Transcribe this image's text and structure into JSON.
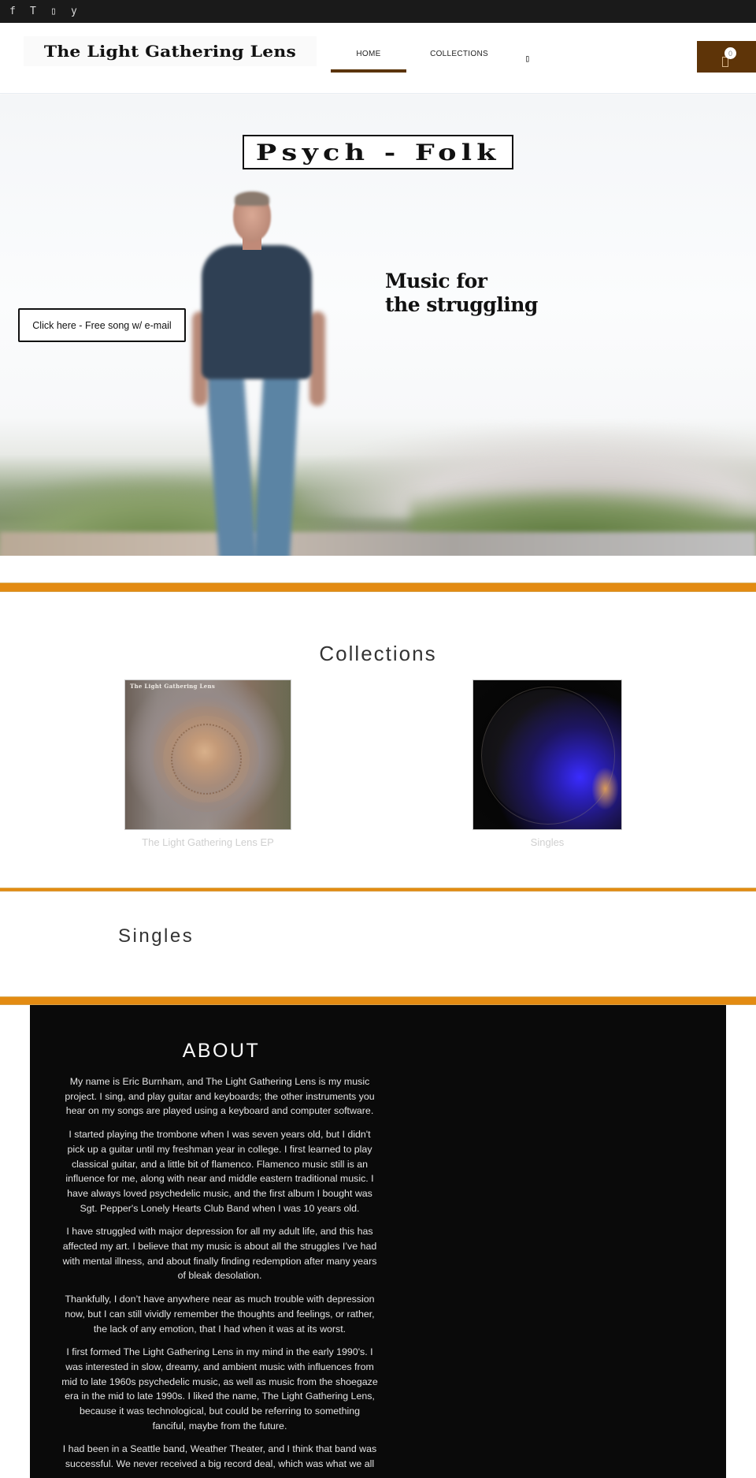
{
  "social": {
    "items": [
      {
        "name": "facebook",
        "glyph": "f"
      },
      {
        "name": "twitter",
        "glyph": "T"
      },
      {
        "name": "instagram",
        "glyph": "▯"
      },
      {
        "name": "youtube",
        "glyph": "y"
      }
    ]
  },
  "header": {
    "logo_text": "The Light Gathering Lens",
    "nav": {
      "home": "HOME",
      "collections": "COLLECTIONS",
      "search_glyph": "▯"
    },
    "cart": {
      "count": "0"
    },
    "accent_color": "#5e3408"
  },
  "hero": {
    "badge": "Psych - Folk",
    "tagline_line1": "Music for",
    "tagline_line2": "the struggling",
    "cta_label": "Click here - Free song w/ e-mail"
  },
  "divider_color": "#e38b12",
  "collections": {
    "title": "Collections",
    "items": [
      {
        "title": "The Light Gathering Lens EP",
        "cover_text": "The Light Gathering Lens"
      },
      {
        "title": "Singles"
      }
    ]
  },
  "singles": {
    "title": "Singles"
  },
  "about": {
    "title": "ABOUT",
    "paragraphs": [
      "My name is Eric Burnham, and The Light Gathering Lens is my music project. I sing, and play guitar and keyboards; the other instruments you hear on my songs are played using a keyboard and computer software.",
      "I started playing the trombone when I was seven years old, but I didn't pick up a guitar until my freshman year in college. I first learned to play classical guitar, and a little bit of flamenco. Flamenco music still is an influence for me, along with near and middle eastern traditional music. I have always loved psychedelic music, and the first album I bought was Sgt. Pepper's Lonely Hearts Club Band when I was 10 years old.",
      "I have struggled with major depression for all my adult life, and this has affected my art. I believe that my music is about all the struggles I’ve had with mental illness, and about finally finding redemption after many years of bleak desolation.",
      "Thankfully, I don’t have anywhere near as much trouble with depression now, but I can still vividly remember the thoughts and feelings, or rather, the lack of any emotion, that I had when it was at its worst.",
      "I first formed The Light Gathering Lens in my mind in the early 1990's. I was interested in slow, dreamy, and ambient music with influences from mid to late 1960s psychedelic music, as well as music from the shoegaze era in the mid to late 1990s. I liked the name, The Light Gathering Lens, because it was technological, but could be referring to something fanciful, maybe from the future.",
      "I had been in a Seattle band, Weather Theater, and I think that band was successful. We never received a big record deal, which was what we all"
    ]
  }
}
